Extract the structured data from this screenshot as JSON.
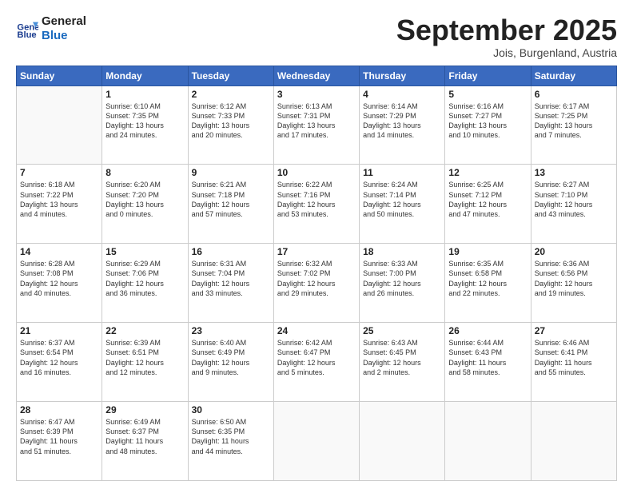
{
  "header": {
    "logo_line1": "General",
    "logo_line2": "Blue",
    "month": "September 2025",
    "location": "Jois, Burgenland, Austria"
  },
  "weekdays": [
    "Sunday",
    "Monday",
    "Tuesday",
    "Wednesday",
    "Thursday",
    "Friday",
    "Saturday"
  ],
  "weeks": [
    [
      {
        "day": "",
        "info": ""
      },
      {
        "day": "1",
        "info": "Sunrise: 6:10 AM\nSunset: 7:35 PM\nDaylight: 13 hours\nand 24 minutes."
      },
      {
        "day": "2",
        "info": "Sunrise: 6:12 AM\nSunset: 7:33 PM\nDaylight: 13 hours\nand 20 minutes."
      },
      {
        "day": "3",
        "info": "Sunrise: 6:13 AM\nSunset: 7:31 PM\nDaylight: 13 hours\nand 17 minutes."
      },
      {
        "day": "4",
        "info": "Sunrise: 6:14 AM\nSunset: 7:29 PM\nDaylight: 13 hours\nand 14 minutes."
      },
      {
        "day": "5",
        "info": "Sunrise: 6:16 AM\nSunset: 7:27 PM\nDaylight: 13 hours\nand 10 minutes."
      },
      {
        "day": "6",
        "info": "Sunrise: 6:17 AM\nSunset: 7:25 PM\nDaylight: 13 hours\nand 7 minutes."
      }
    ],
    [
      {
        "day": "7",
        "info": "Sunrise: 6:18 AM\nSunset: 7:22 PM\nDaylight: 13 hours\nand 4 minutes."
      },
      {
        "day": "8",
        "info": "Sunrise: 6:20 AM\nSunset: 7:20 PM\nDaylight: 13 hours\nand 0 minutes."
      },
      {
        "day": "9",
        "info": "Sunrise: 6:21 AM\nSunset: 7:18 PM\nDaylight: 12 hours\nand 57 minutes."
      },
      {
        "day": "10",
        "info": "Sunrise: 6:22 AM\nSunset: 7:16 PM\nDaylight: 12 hours\nand 53 minutes."
      },
      {
        "day": "11",
        "info": "Sunrise: 6:24 AM\nSunset: 7:14 PM\nDaylight: 12 hours\nand 50 minutes."
      },
      {
        "day": "12",
        "info": "Sunrise: 6:25 AM\nSunset: 7:12 PM\nDaylight: 12 hours\nand 47 minutes."
      },
      {
        "day": "13",
        "info": "Sunrise: 6:27 AM\nSunset: 7:10 PM\nDaylight: 12 hours\nand 43 minutes."
      }
    ],
    [
      {
        "day": "14",
        "info": "Sunrise: 6:28 AM\nSunset: 7:08 PM\nDaylight: 12 hours\nand 40 minutes."
      },
      {
        "day": "15",
        "info": "Sunrise: 6:29 AM\nSunset: 7:06 PM\nDaylight: 12 hours\nand 36 minutes."
      },
      {
        "day": "16",
        "info": "Sunrise: 6:31 AM\nSunset: 7:04 PM\nDaylight: 12 hours\nand 33 minutes."
      },
      {
        "day": "17",
        "info": "Sunrise: 6:32 AM\nSunset: 7:02 PM\nDaylight: 12 hours\nand 29 minutes."
      },
      {
        "day": "18",
        "info": "Sunrise: 6:33 AM\nSunset: 7:00 PM\nDaylight: 12 hours\nand 26 minutes."
      },
      {
        "day": "19",
        "info": "Sunrise: 6:35 AM\nSunset: 6:58 PM\nDaylight: 12 hours\nand 22 minutes."
      },
      {
        "day": "20",
        "info": "Sunrise: 6:36 AM\nSunset: 6:56 PM\nDaylight: 12 hours\nand 19 minutes."
      }
    ],
    [
      {
        "day": "21",
        "info": "Sunrise: 6:37 AM\nSunset: 6:54 PM\nDaylight: 12 hours\nand 16 minutes."
      },
      {
        "day": "22",
        "info": "Sunrise: 6:39 AM\nSunset: 6:51 PM\nDaylight: 12 hours\nand 12 minutes."
      },
      {
        "day": "23",
        "info": "Sunrise: 6:40 AM\nSunset: 6:49 PM\nDaylight: 12 hours\nand 9 minutes."
      },
      {
        "day": "24",
        "info": "Sunrise: 6:42 AM\nSunset: 6:47 PM\nDaylight: 12 hours\nand 5 minutes."
      },
      {
        "day": "25",
        "info": "Sunrise: 6:43 AM\nSunset: 6:45 PM\nDaylight: 12 hours\nand 2 minutes."
      },
      {
        "day": "26",
        "info": "Sunrise: 6:44 AM\nSunset: 6:43 PM\nDaylight: 11 hours\nand 58 minutes."
      },
      {
        "day": "27",
        "info": "Sunrise: 6:46 AM\nSunset: 6:41 PM\nDaylight: 11 hours\nand 55 minutes."
      }
    ],
    [
      {
        "day": "28",
        "info": "Sunrise: 6:47 AM\nSunset: 6:39 PM\nDaylight: 11 hours\nand 51 minutes."
      },
      {
        "day": "29",
        "info": "Sunrise: 6:49 AM\nSunset: 6:37 PM\nDaylight: 11 hours\nand 48 minutes."
      },
      {
        "day": "30",
        "info": "Sunrise: 6:50 AM\nSunset: 6:35 PM\nDaylight: 11 hours\nand 44 minutes."
      },
      {
        "day": "",
        "info": ""
      },
      {
        "day": "",
        "info": ""
      },
      {
        "day": "",
        "info": ""
      },
      {
        "day": "",
        "info": ""
      }
    ]
  ]
}
